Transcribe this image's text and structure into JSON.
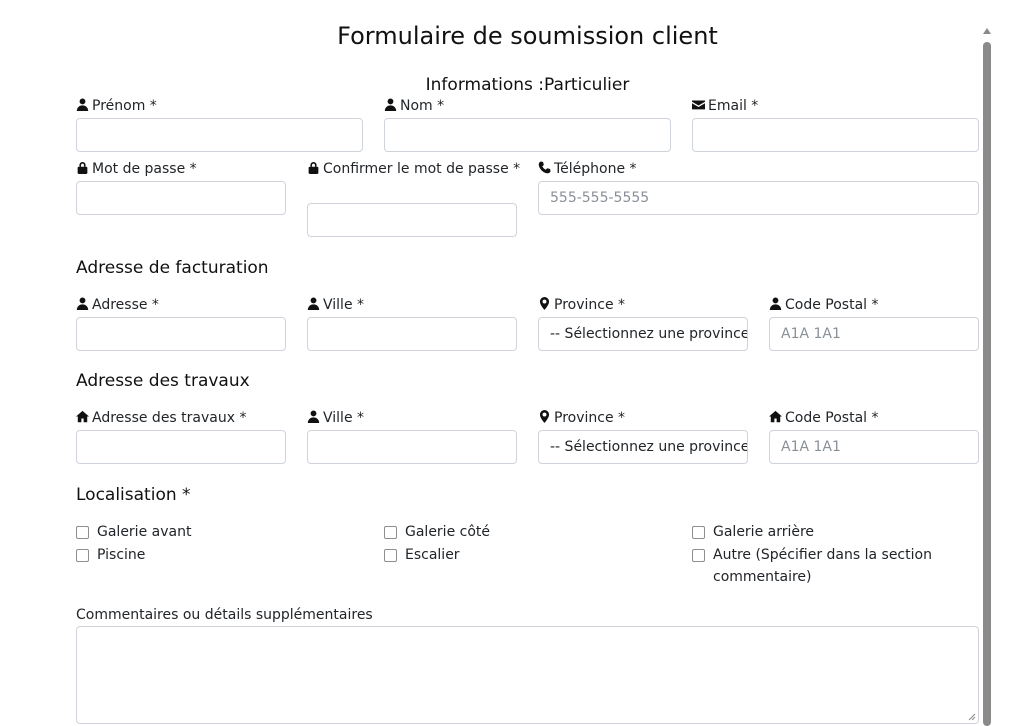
{
  "form": {
    "title": "Formulaire de soumission client",
    "subtitle": "Informations :Particulier"
  },
  "personal": {
    "prenom_label": "Prénom *",
    "nom_label": "Nom *",
    "email_label": "Email *",
    "password_label": "Mot de passe *",
    "confirm_password_label": "Confirmer le mot de passe *",
    "phone_label": "Téléphone *",
    "phone_placeholder": "555-555-5555"
  },
  "billing": {
    "heading": "Adresse de facturation",
    "address_label": "Adresse *",
    "city_label": "Ville *",
    "province_label": "Province *",
    "province_selected": "-- Sélectionnez une province --",
    "postal_label": "Code Postal *",
    "postal_placeholder": "A1A 1A1"
  },
  "works": {
    "heading": "Adresse des travaux",
    "address_label": "Adresse des travaux *",
    "city_label": "Ville *",
    "province_label": "Province *",
    "province_selected": "-- Sélectionnez une province --",
    "postal_label": "Code Postal *",
    "postal_placeholder": "A1A 1A1"
  },
  "location": {
    "heading": "Localisation *",
    "options": [
      "Galerie avant",
      "Galerie côté",
      "Galerie arrière",
      "Piscine",
      "Escalier",
      "Autre (Spécifier dans la section commentaire)"
    ]
  },
  "comments": {
    "label": "Commentaires ou détails supplémentaires"
  },
  "icons": {
    "user": "user-icon",
    "envelope": "envelope-icon",
    "lock": "lock-icon",
    "phone": "phone-icon",
    "map_marker": "map-marker-icon",
    "home": "home-icon"
  }
}
